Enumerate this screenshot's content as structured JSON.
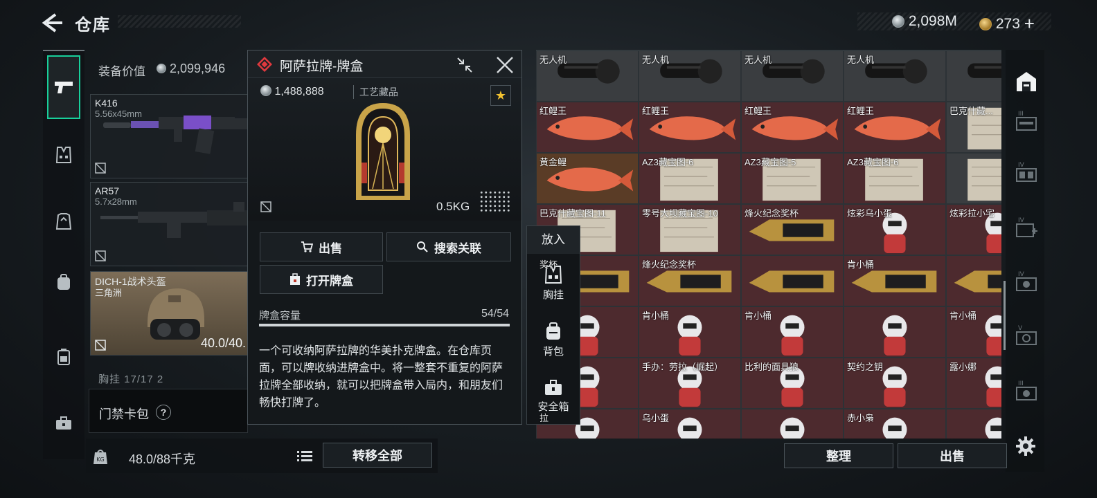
{
  "header": {
    "title": "仓库",
    "silver_currency": "2,098M",
    "gold_currency": "273",
    "gold_add": "+"
  },
  "equipment": {
    "value_label": "装备价值",
    "value": "2,099,946",
    "items": [
      {
        "name": "K416",
        "sub": "5.56x45mm"
      },
      {
        "name": "AR57",
        "sub": "5.7x28mm"
      },
      {
        "name": "DICH-1战术头盔",
        "sub": "三角洲",
        "durability": "40.0/40."
      }
    ],
    "vest_row": "胸挂  17/17 2",
    "keycard_label": "门禁卡包",
    "help_glyph": "?",
    "weight": "48.0/88千克",
    "transfer_all": "转移全部"
  },
  "popup": {
    "title": "阿萨拉牌-牌盒",
    "price": "1,488,888",
    "category": "工艺藏品",
    "star": "★",
    "weight": "0.5KG",
    "sell_label": "出售",
    "search_label": "搜索关联",
    "open_label": "打开牌盒",
    "capacity_label": "牌盒容量",
    "capacity_value": "54/54",
    "capacity_fraction": 1.0,
    "description": "一个可收纳阿萨拉牌的华美扑克牌盒。在仓库页面，可以牌收纳进牌盒中。将一整套不重复的阿萨拉牌全部收纳，就可以把牌盒带入局内，和朋友们畅快打牌了。"
  },
  "put_menu": {
    "title": "放入",
    "items": [
      "胸挂",
      "背包",
      "安全箱"
    ]
  },
  "grid": {
    "rows": [
      [
        "无人机",
        "无人机",
        "无人机",
        "无人机",
        ""
      ],
      [
        "红鲤王",
        "红鲤王",
        "红鲤王",
        "红鲤王",
        "巴克什藏..."
      ],
      [
        "黄金鲤",
        "AZ3藏宝图-6",
        "AZ3藏宝图-5",
        "AZ3藏宝图-6",
        ""
      ],
      [
        "巴克什藏宝图-11",
        "零号大坝藏宝图-10",
        "烽火纪念奖杯",
        "炫彩乌小蛋",
        "炫彩拉小宅"
      ],
      [
        "奖杯",
        "烽火纪念奖杯",
        "",
        "肯小桶",
        ""
      ],
      [
        "",
        "肯小桶",
        "肯小桶",
        "",
        "肯小桶"
      ],
      [
        "",
        "手办：劳拉（崛起）",
        "比利的面具狼",
        "契约之钥",
        "露小娜"
      ],
      [
        "拉",
        "乌小蛋",
        "",
        "赤小枭",
        ""
      ]
    ],
    "arrange_label": "整理",
    "sell_label": "出售"
  },
  "colors": {
    "accent": "#18d09b",
    "cell_red": "#4d2a2e",
    "cell_gold": "#5a3c26",
    "star": "#f2c230"
  }
}
